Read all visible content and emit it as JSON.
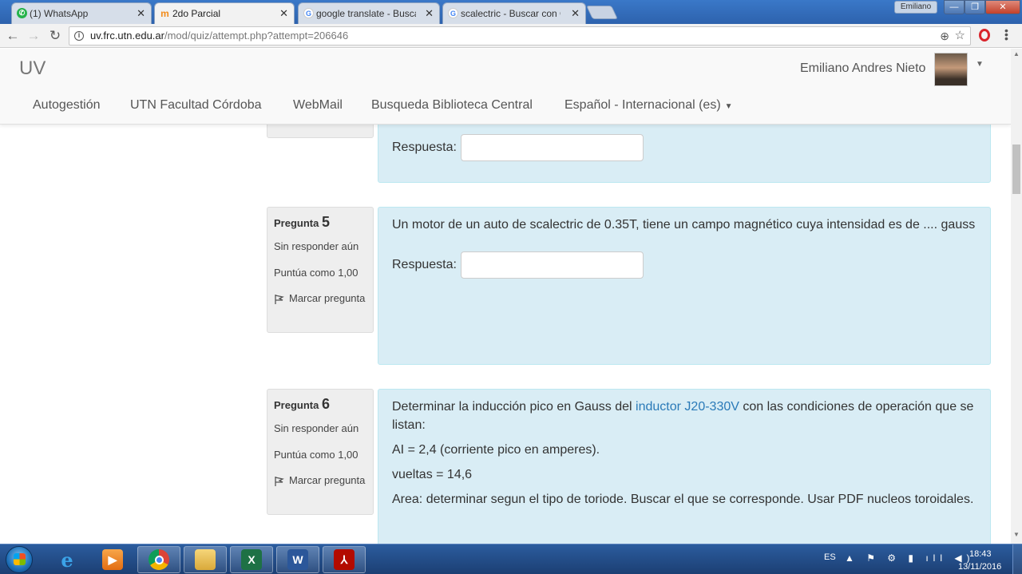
{
  "browser": {
    "tabs": [
      {
        "title": "(1) WhatsApp",
        "favicon": "whatsapp-icon",
        "active": false
      },
      {
        "title": "2do Parcial",
        "favicon": "moodle-icon",
        "active": true
      },
      {
        "title": "google translate - Buscar",
        "favicon": "google-icon",
        "active": false
      },
      {
        "title": "scalectric - Buscar con Go",
        "favicon": "google-icon",
        "active": false
      }
    ],
    "close_glyph": "✕",
    "user_chip": "Emiliano",
    "url_host": "uv.frc.utn.edu.ar",
    "url_path": "/mod/quiz/attempt.php?attempt=206646"
  },
  "site": {
    "brand": "UV",
    "user_name": "Emiliano Andres Nieto",
    "nav": [
      {
        "label": "Autogestión"
      },
      {
        "label": "UTN Facultad Córdoba"
      },
      {
        "label": "WebMail"
      },
      {
        "label": "Busqueda Biblioteca Central"
      },
      {
        "label": "Español - Internacional (es)"
      }
    ]
  },
  "quiz": {
    "previous": {
      "answer_label": "Respuesta:"
    },
    "questions": [
      {
        "label": "Pregunta",
        "number": "5",
        "status": "Sin responder aún",
        "score": "Puntúa como 1,00",
        "flag_label": "Marcar pregunta",
        "text": "Un motor de un auto de scalectric de 0.35T, tiene un campo magnético cuya intensidad es de .... gauss",
        "answer_label": "Respuesta:",
        "answer_value": ""
      },
      {
        "label": "Pregunta",
        "number": "6",
        "status": "Sin responder aún",
        "score": "Puntúa como 1,00",
        "flag_label": "Marcar pregunta",
        "text_before_link": "Determinar la inducción pico en Gauss del ",
        "link_text": "inductor J20-330V",
        "text_after_link": " con las condiciones de operación que se listan:",
        "line_2": "AI = 2,4 (corriente pico en amperes).",
        "line_3": "vueltas = 14,6",
        "line_4": "Area: determinar segun el tipo de toriode. Buscar el que se corresponde. Usar PDF nucleos toroidales."
      }
    ]
  },
  "taskbar": {
    "language": "ES",
    "time": "18:43",
    "date": "13/11/2016"
  },
  "colors": {
    "question_bg": "#d9edf5",
    "info_bg": "#eeeeee",
    "link": "#2a7ab8",
    "taskbar": "#1c3f73"
  }
}
